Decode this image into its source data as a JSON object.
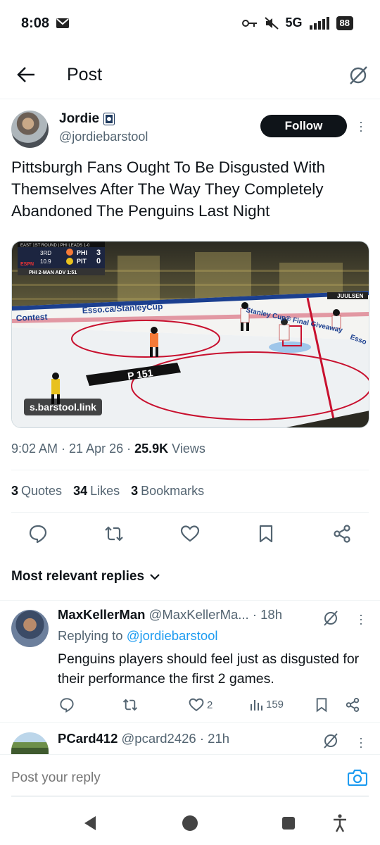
{
  "status_bar": {
    "time": "8:08",
    "network": "5G",
    "battery": "88"
  },
  "header": {
    "title": "Post"
  },
  "post": {
    "author_name": "Jordie",
    "author_handle": "@jordiebarstool",
    "follow_label": "Follow",
    "text": "Pittsburgh Fans Ought To Be Disgusted With Themselves After The Way They Completely Abandoned The Penguins Last Night",
    "media": {
      "link_badge": "s.barstool.link",
      "scorebug_line1": "EAST 1ST ROUND | PHI LEADS 1-0",
      "period": "3RD",
      "team_away": "PHI",
      "score_away": "3",
      "clock": "10.9",
      "team_home": "PIT",
      "score_home": "0",
      "powerplay": "PHI 2-MAN ADV 1:51",
      "board_ad_1": "Contest",
      "board_ad_2": "Esso.ca/StanleyCup",
      "board_ad_3": "Stanley Cup® Final Giveaway",
      "board_ad_4": "Esso",
      "player_tag": "JUULSEN",
      "ice_ad": "P 151",
      "network_logo": "ESPN"
    },
    "time": "9:02 AM",
    "date": "21 Apr 26",
    "views_count": "25.9K",
    "views_label": "Views",
    "quotes_count": "3",
    "quotes_label": "Quotes",
    "likes_count": "34",
    "likes_label": "Likes",
    "bookmarks_count": "3",
    "bookmarks_label": "Bookmarks"
  },
  "replies_filter": {
    "label": "Most relevant replies"
  },
  "replies": [
    {
      "name": "MaxKellerMan",
      "handle": "@MaxKellerMa...",
      "age": "· 18h",
      "replying_prefix": "Replying to",
      "replying_to": "@jordiebarstool",
      "text": "Penguins players should feel just as disgusted for their performance the first 2 games.",
      "likes": "2",
      "views": "159"
    },
    {
      "name": "PCard412",
      "handle": "@pcard2426",
      "age": "· 21h"
    }
  ],
  "compose": {
    "placeholder": "Post your reply"
  },
  "colors": {
    "accent": "#1d9bf0",
    "text": "#0f1419",
    "muted": "#536471"
  }
}
